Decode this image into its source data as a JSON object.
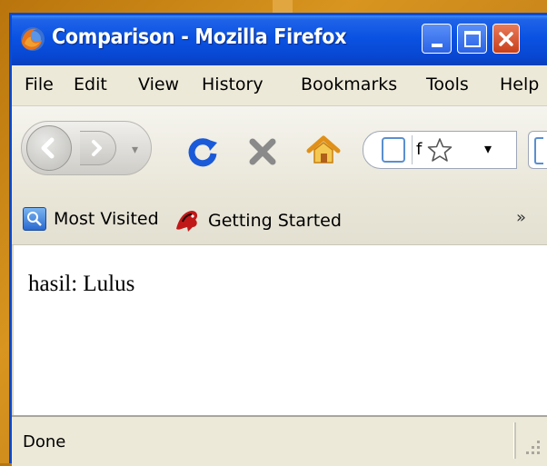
{
  "window": {
    "title": "Comparison - Mozilla Firefox"
  },
  "menu": [
    "File",
    "Edit",
    "View",
    "History",
    "Bookmarks",
    "Tools",
    "Help"
  ],
  "navigation": {
    "url_text": "f",
    "history_dropdown": "▾",
    "url_dropdown": "▾"
  },
  "bookmarks": {
    "items": [
      "Most Visited",
      "Getting Started"
    ],
    "overflow": "»"
  },
  "page": {
    "text": "hasil: Lulus"
  },
  "status": {
    "text": "Done"
  },
  "colors": {
    "titlebar": "#0a52e2",
    "close_button": "#c8401a",
    "reload": "#1a5ad8",
    "stop": "#8a8a8a",
    "home": "#e8a020"
  },
  "icons": [
    "firefox-logo-icon",
    "minimize-icon",
    "maximize-icon",
    "close-icon",
    "back-arrow-icon",
    "forward-arrow-icon",
    "reload-icon",
    "stop-icon",
    "home-icon",
    "page-icon",
    "star-icon",
    "most-visited-icon",
    "getting-started-icon",
    "resize-grip-icon"
  ]
}
